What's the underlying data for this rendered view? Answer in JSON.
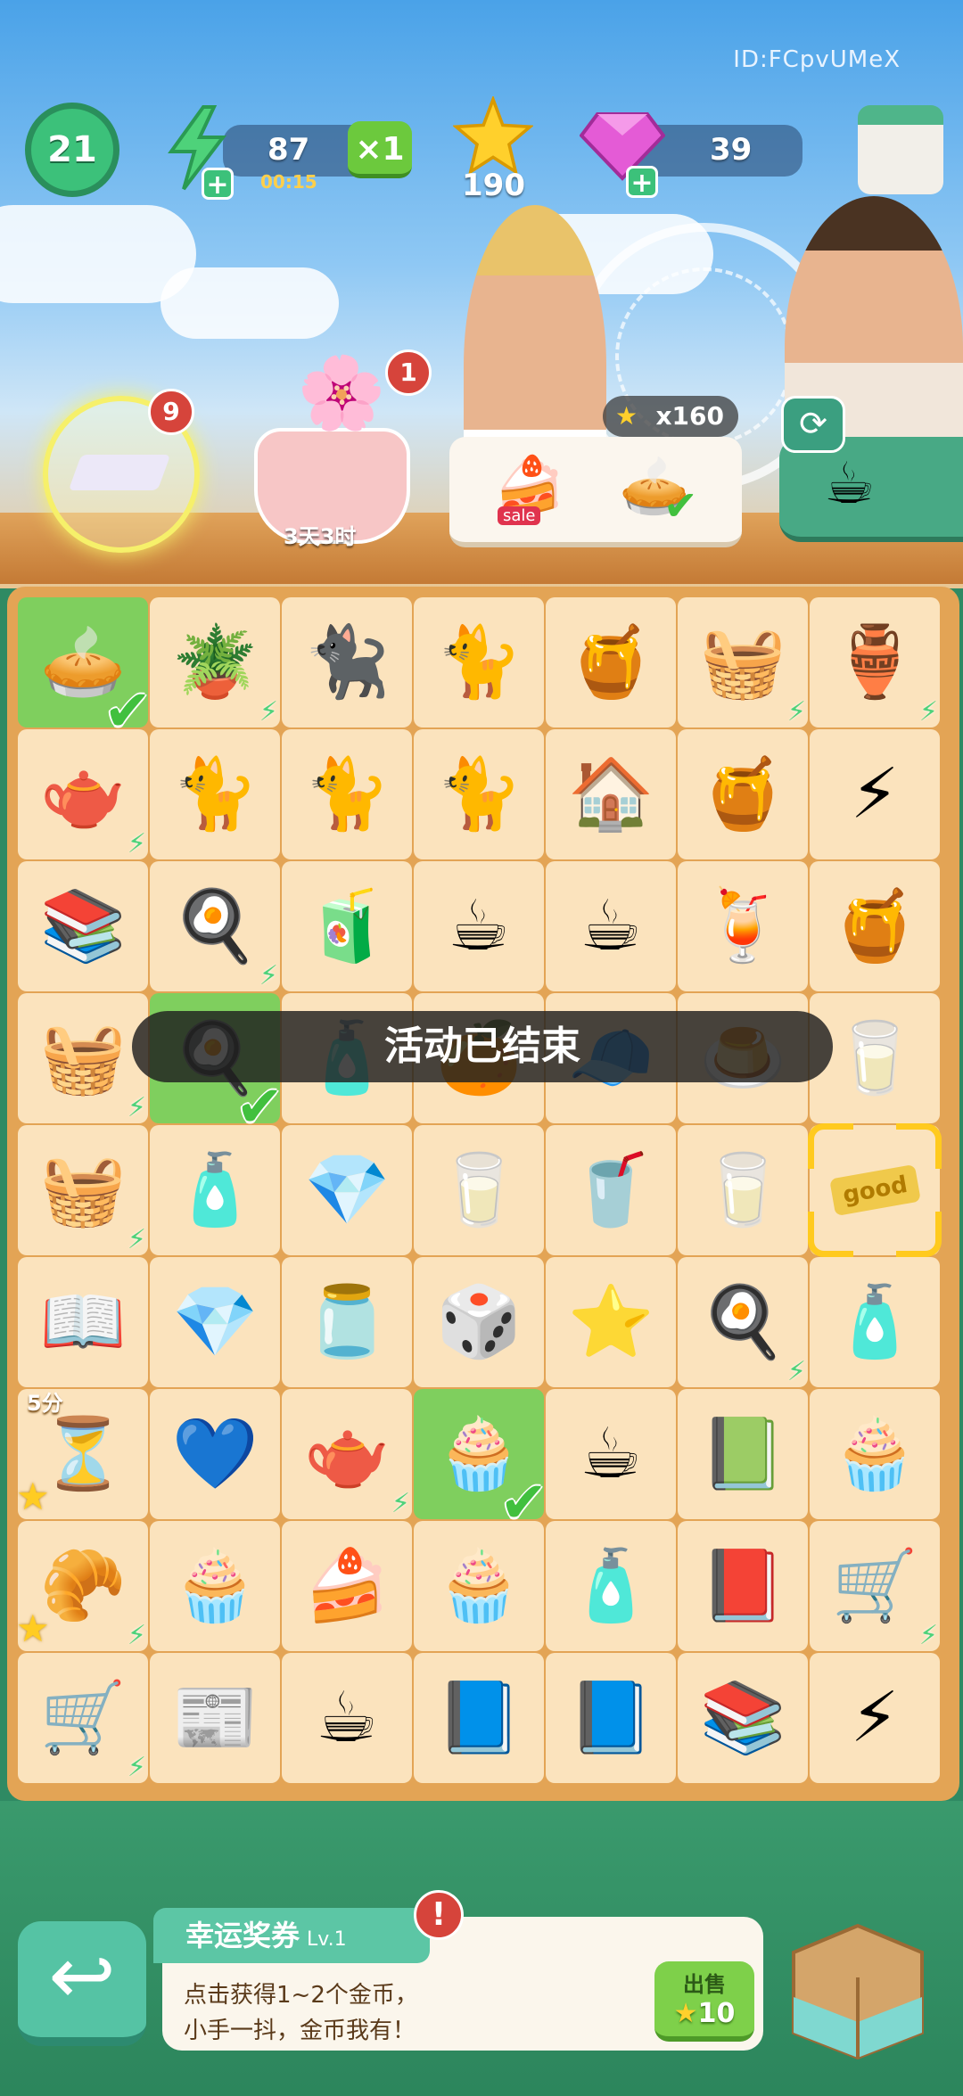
{
  "header": {
    "player_id": "ID:FCpvUMeX",
    "level": "21",
    "energy": "87",
    "energy_timer": "00:15",
    "multiplier": "×1",
    "stars": "190",
    "gems": "39"
  },
  "scene": {
    "quest_badge": "9",
    "pot_badge": "1",
    "pot_timer": "3天3时",
    "reward": "x160",
    "order_sale_label": "sale"
  },
  "board": {
    "rows": [
      [
        {
          "icon": "🥧",
          "name": "fruit-pie",
          "done": true
        },
        {
          "icon": "🪴",
          "name": "potted-plant",
          "bolt": true
        },
        {
          "icon": "🐈‍⬛",
          "name": "black-cat"
        },
        {
          "icon": "🐈",
          "name": "tabby-cat"
        },
        {
          "icon": "🍯",
          "name": "honeycomb"
        },
        {
          "icon": "🧺",
          "name": "fruit-basket",
          "bolt": true
        },
        {
          "icon": "🏺",
          "name": "cat-bed",
          "bolt": true
        }
      ],
      [
        {
          "icon": "🫖",
          "name": "tea-tray",
          "bolt": true
        },
        {
          "icon": "🐈",
          "name": "brown-cat"
        },
        {
          "icon": "🐈",
          "name": "siamese-cat"
        },
        {
          "icon": "🐈",
          "name": "calico-cat"
        },
        {
          "icon": "🏠",
          "name": "bee-house"
        },
        {
          "icon": "🍯",
          "name": "honey-jar"
        },
        {
          "icon": "⚡",
          "name": "energy-bolt"
        }
      ],
      [
        {
          "icon": "📚",
          "name": "books-stack"
        },
        {
          "icon": "🍳",
          "name": "green-stove",
          "bolt": true
        },
        {
          "icon": "🧃",
          "name": "green-toaster"
        },
        {
          "icon": "☕",
          "name": "tea-cup"
        },
        {
          "icon": "☕",
          "name": "coffee-mug"
        },
        {
          "icon": "🍹",
          "name": "lemonade"
        },
        {
          "icon": "🍯",
          "name": "honeycomb-2"
        }
      ],
      [
        {
          "icon": "🧺",
          "name": "cat-shelf",
          "bolt": true
        },
        {
          "icon": "🍳",
          "name": "egg-toast",
          "done": true
        },
        {
          "icon": "🧴",
          "name": "bottle"
        },
        {
          "icon": "🍊",
          "name": "orange"
        },
        {
          "icon": "🧢",
          "name": "blue-item"
        },
        {
          "icon": "🍮",
          "name": "pudding"
        },
        {
          "icon": "🥛",
          "name": "water-glass"
        }
      ],
      [
        {
          "icon": "🧺",
          "name": "veggie-basket",
          "bolt": true
        },
        {
          "icon": "🧴",
          "name": "small-bottle"
        },
        {
          "icon": "💎",
          "name": "pink-gems"
        },
        {
          "icon": "🥛",
          "name": "milk-carton"
        },
        {
          "icon": "🥤",
          "name": "paper-cup"
        },
        {
          "icon": "🥛",
          "name": "glass"
        },
        {
          "icon": "🎫",
          "name": "good-ticket",
          "selected": true,
          "ticket": "good"
        }
      ],
      [
        {
          "icon": "📖",
          "name": "popup-book"
        },
        {
          "icon": "💎",
          "name": "gem-pile"
        },
        {
          "icon": "🫙",
          "name": "candy-jar"
        },
        {
          "icon": "🎲",
          "name": "board-game"
        },
        {
          "icon": "⭐",
          "name": "star-pile"
        },
        {
          "icon": "🍳",
          "name": "green-oven",
          "bolt": true
        },
        {
          "icon": "🧴",
          "name": "perfume"
        }
      ],
      [
        {
          "icon": "⏳",
          "name": "hourglass",
          "timer": "5分",
          "star": true
        },
        {
          "icon": "💙",
          "name": "blue-bag"
        },
        {
          "icon": "🫖",
          "name": "tea-set",
          "bolt": true
        },
        {
          "icon": "🧁",
          "name": "cherry-cupcake",
          "done": true
        },
        {
          "icon": "☕",
          "name": "coffee-cup"
        },
        {
          "icon": "📗",
          "name": "picture-book"
        },
        {
          "icon": "🧁",
          "name": "matcha-cupcake"
        }
      ],
      [
        {
          "icon": "🥐",
          "name": "bread-basket",
          "bolt": true,
          "star": true
        },
        {
          "icon": "🧁",
          "name": "pink-cupcake"
        },
        {
          "icon": "🍰",
          "name": "cake-slice"
        },
        {
          "icon": "🧁",
          "name": "green-cupcake"
        },
        {
          "icon": "🧴",
          "name": "flower-perfume"
        },
        {
          "icon": "📕",
          "name": "red-book"
        },
        {
          "icon": "🛒",
          "name": "book-cart",
          "bolt": true
        }
      ],
      [
        {
          "icon": "🛒",
          "name": "book-cart-2",
          "bolt": true
        },
        {
          "icon": "📰",
          "name": "newspaper"
        },
        {
          "icon": "☕",
          "name": "takeaway-coffee"
        },
        {
          "icon": "📘",
          "name": "blue-book"
        },
        {
          "icon": "📘",
          "name": "blue-book-2"
        },
        {
          "icon": "📚",
          "name": "book-pile"
        },
        {
          "icon": "⚡",
          "name": "energy-pile"
        }
      ]
    ]
  },
  "banner": "活动已结束",
  "bottom": {
    "item_title": "幸运奖券",
    "item_level": "Lv.1",
    "alert": "!",
    "desc_line1": "点击获得1~2个金币，",
    "desc_line2": "小手一抖，金币我有！",
    "sell_label": "出售",
    "sell_price": "10"
  },
  "colors": {
    "board": "#e3a455",
    "cell": "#fbe3bd",
    "cell_done": "#7fcf5e",
    "accent_green": "#3cc17a",
    "selection": "#ffca1e"
  }
}
